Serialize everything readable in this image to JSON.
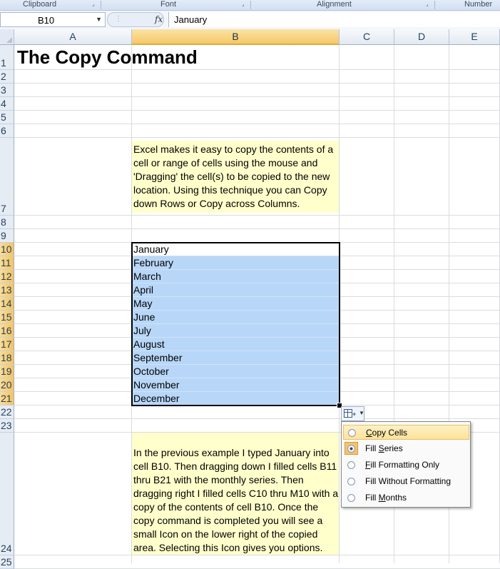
{
  "ribbon": {
    "groups": [
      {
        "label": "Clipboard"
      },
      {
        "label": "Font"
      },
      {
        "label": "Alignment"
      },
      {
        "label": "Number"
      }
    ]
  },
  "formula_bar": {
    "name_box": "B10",
    "fx_label": "fx",
    "formula": "January"
  },
  "columns": [
    "A",
    "B",
    "C",
    "D",
    "E"
  ],
  "rows": [
    "1",
    "2",
    "3",
    "4",
    "5",
    "6",
    "7",
    "8",
    "9",
    "10",
    "11",
    "12",
    "13",
    "14",
    "15",
    "16",
    "17",
    "18",
    "19",
    "20",
    "21",
    "22",
    "23",
    "24",
    "25"
  ],
  "sheet": {
    "title": "The Copy Command",
    "note1": "Excel makes it easy to copy the contents of a cell or range of cells using the mouse and 'Dragging' the cell(s) to be copied to the new location. Using this technique you can Copy down Rows or Copy across Columns.",
    "months": [
      "January",
      "February",
      "March",
      "April",
      "May",
      "June",
      "July",
      "August",
      "September",
      "October",
      "November",
      "December"
    ],
    "note2": "In the previous example I typed January into cell B10. Then dragging down I filled cells B11 thru B21 with the monthly series. Then dragging right I filled cells C10 thru M10 with a copy of the contents of cell B10. Once the copy command is completed you will see a small Icon on the lower right of the copied area. Selecting this Icon gives you options."
  },
  "autofill_menu": {
    "items": [
      {
        "label": "Copy Cells",
        "mnemonic": "C",
        "selected": false,
        "hover": true
      },
      {
        "label": "Fill Series",
        "mnemonic": "S",
        "selected": true,
        "hover": false
      },
      {
        "label": "Fill Formatting Only",
        "mnemonic": "F",
        "selected": false,
        "hover": false
      },
      {
        "label": "Fill Without Formatting",
        "mnemonic": "O",
        "selected": false,
        "hover": false
      },
      {
        "label": "Fill Months",
        "mnemonic": "M",
        "selected": false,
        "hover": false
      }
    ]
  },
  "colors": {
    "selection_fill": "#b8d7f8",
    "note_fill": "#ffffcc",
    "header_selected": "#f6c969",
    "menu_hover": "#fde29a"
  }
}
